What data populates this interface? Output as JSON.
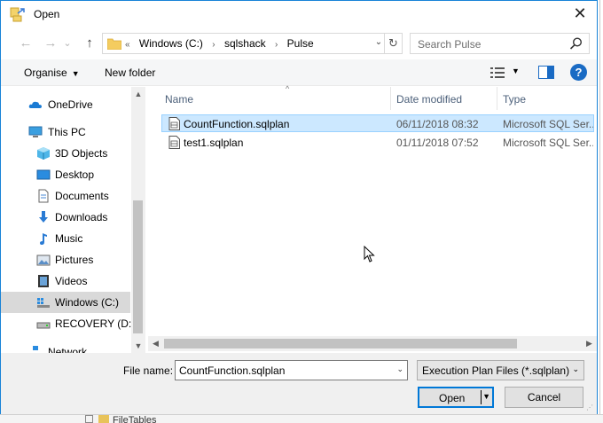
{
  "window": {
    "title": "Open",
    "close_glyph": "✕"
  },
  "navigation": {
    "back_glyph": "←",
    "forward_glyph": "→",
    "recent_glyph": "⌄",
    "up_glyph": "↑",
    "breadcrumb_prefix": "«",
    "breadcrumb": [
      "Windows (C:)",
      "sqlshack",
      "Pulse"
    ],
    "separator_glyph": "›",
    "dropdown_glyph": "⌄",
    "refresh_glyph": "↻",
    "search_placeholder": "Search Pulse"
  },
  "toolbar": {
    "organise_label": "Organise",
    "caret_glyph": "▼",
    "new_folder_label": "New folder",
    "help_glyph": "?"
  },
  "sidebar": {
    "items": [
      {
        "label": "OneDrive",
        "icon": "cloud-icon"
      },
      {
        "label": "This PC",
        "icon": "computer-icon"
      },
      {
        "label": "3D Objects",
        "icon": "cube-icon"
      },
      {
        "label": "Desktop",
        "icon": "desktop-icon"
      },
      {
        "label": "Documents",
        "icon": "document-icon"
      },
      {
        "label": "Downloads",
        "icon": "download-icon"
      },
      {
        "label": "Music",
        "icon": "music-icon"
      },
      {
        "label": "Pictures",
        "icon": "picture-icon"
      },
      {
        "label": "Videos",
        "icon": "video-icon"
      },
      {
        "label": "Windows (C:)",
        "icon": "drive-icon",
        "selected": true
      },
      {
        "label": "RECOVERY (D:)",
        "icon": "drive-icon"
      },
      {
        "label": "Network",
        "icon": "network-icon"
      }
    ],
    "scroll_up_glyph": "▲",
    "scroll_down_glyph": "▼"
  },
  "file_list": {
    "columns": [
      "Name",
      "Date modified",
      "Type"
    ],
    "sort_glyph": "^",
    "rows": [
      {
        "name": "CountFunction.sqlplan",
        "date": "06/11/2018 08:32",
        "type": "Microsoft SQL Ser...",
        "selected": true
      },
      {
        "name": "test1.sqlplan",
        "date": "01/11/2018 07:52",
        "type": "Microsoft SQL Ser...",
        "selected": false
      }
    ],
    "scroll_left_glyph": "◀",
    "scroll_right_glyph": "▶"
  },
  "footer": {
    "file_name_label": "File name:",
    "file_name_value": "CountFunction.sqlplan",
    "filter_value": "Execution Plan Files (*.sqlplan)",
    "dropdown_glyph": "⌄",
    "open_label": "Open",
    "open_dropdown_glyph": "▼",
    "cancel_label": "Cancel",
    "grip_glyph": "⋰"
  },
  "background": {
    "partial_text": "FileTables"
  },
  "colors": {
    "accent": "#0078d7",
    "selection": "#cce8ff",
    "sidebar_selected": "#d9d9d9"
  }
}
